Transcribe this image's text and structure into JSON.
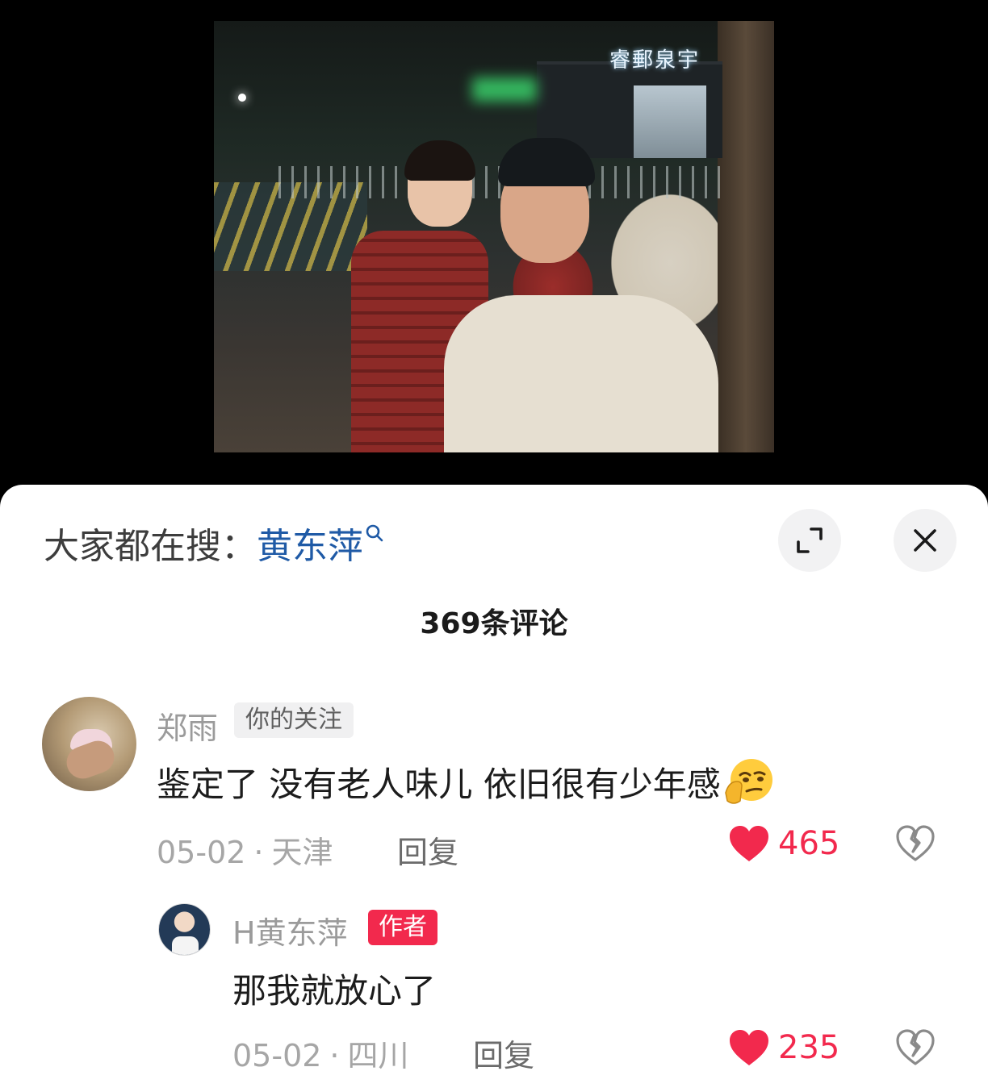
{
  "photo": {
    "sign_text": "睿郵泉宇"
  },
  "search": {
    "prefix": "大家都在搜：",
    "keyword": "黄东萍",
    "icon": "search-icon"
  },
  "buttons": {
    "expand_icon": "expand-icon",
    "close_icon": "close-icon"
  },
  "comments_header": {
    "title": "369条评论"
  },
  "comments": [
    {
      "username": "郑雨",
      "tag": "你的关注",
      "text": "鉴定了 没有老人味儿 依旧很有少年感",
      "emoji": "thinking-smirk-emoji",
      "date": "05-02",
      "separator": "·",
      "location": "天津",
      "reply_label": "回复",
      "likes": "465"
    },
    {
      "username": "H黄东萍",
      "tag": "作者",
      "text": "那我就放心了",
      "date": "05-02",
      "separator": "·",
      "location": "四川",
      "reply_label": "回复",
      "likes": "235"
    }
  ],
  "colors": {
    "accent_red": "#f2294d",
    "keyword_blue": "#1f5aa6"
  }
}
